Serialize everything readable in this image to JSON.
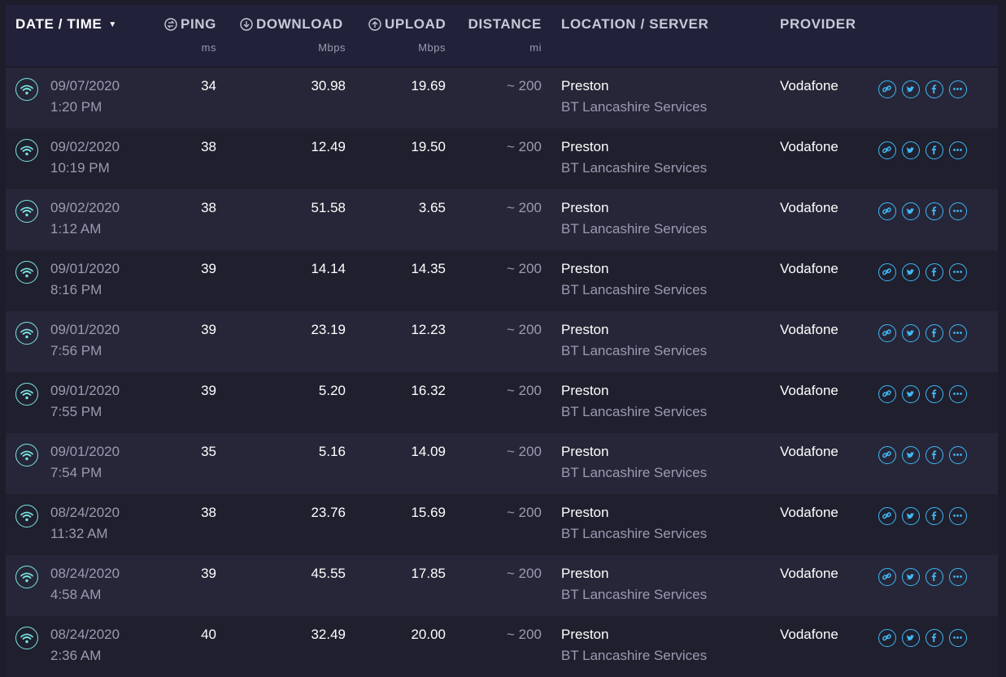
{
  "header": {
    "date_label": "DATE / TIME",
    "ping_label": "PING",
    "ping_unit": "ms",
    "download_label": "DOWNLOAD",
    "download_unit": "Mbps",
    "upload_label": "UPLOAD",
    "upload_unit": "Mbps",
    "distance_label": "DISTANCE",
    "distance_unit": "mi",
    "location_label": "LOCATION / SERVER",
    "provider_label": "PROVIDER"
  },
  "rows": [
    {
      "date": "09/07/2020",
      "time": "1:20 PM",
      "ping": "34",
      "download": "30.98",
      "upload": "19.69",
      "distance": "~ 200",
      "location": "Preston",
      "server": "BT Lancashire Services",
      "provider": "Vodafone"
    },
    {
      "date": "09/02/2020",
      "time": "10:19 PM",
      "ping": "38",
      "download": "12.49",
      "upload": "19.50",
      "distance": "~ 200",
      "location": "Preston",
      "server": "BT Lancashire Services",
      "provider": "Vodafone"
    },
    {
      "date": "09/02/2020",
      "time": "1:12 AM",
      "ping": "38",
      "download": "51.58",
      "upload": "3.65",
      "distance": "~ 200",
      "location": "Preston",
      "server": "BT Lancashire Services",
      "provider": "Vodafone"
    },
    {
      "date": "09/01/2020",
      "time": "8:16 PM",
      "ping": "39",
      "download": "14.14",
      "upload": "14.35",
      "distance": "~ 200",
      "location": "Preston",
      "server": "BT Lancashire Services",
      "provider": "Vodafone"
    },
    {
      "date": "09/01/2020",
      "time": "7:56 PM",
      "ping": "39",
      "download": "23.19",
      "upload": "12.23",
      "distance": "~ 200",
      "location": "Preston",
      "server": "BT Lancashire Services",
      "provider": "Vodafone"
    },
    {
      "date": "09/01/2020",
      "time": "7:55 PM",
      "ping": "39",
      "download": "5.20",
      "upload": "16.32",
      "distance": "~ 200",
      "location": "Preston",
      "server": "BT Lancashire Services",
      "provider": "Vodafone"
    },
    {
      "date": "09/01/2020",
      "time": "7:54 PM",
      "ping": "35",
      "download": "5.16",
      "upload": "14.09",
      "distance": "~ 200",
      "location": "Preston",
      "server": "BT Lancashire Services",
      "provider": "Vodafone"
    },
    {
      "date": "08/24/2020",
      "time": "11:32 AM",
      "ping": "38",
      "download": "23.76",
      "upload": "15.69",
      "distance": "~ 200",
      "location": "Preston",
      "server": "BT Lancashire Services",
      "provider": "Vodafone"
    },
    {
      "date": "08/24/2020",
      "time": "4:58 AM",
      "ping": "39",
      "download": "45.55",
      "upload": "17.85",
      "distance": "~ 200",
      "location": "Preston",
      "server": "BT Lancashire Services",
      "provider": "Vodafone"
    },
    {
      "date": "08/24/2020",
      "time": "2:36 AM",
      "ping": "40",
      "download": "32.49",
      "upload": "20.00",
      "distance": "~ 200",
      "location": "Preston",
      "server": "BT Lancashire Services",
      "provider": "Vodafone"
    }
  ],
  "row_icon": "wifi-icon",
  "action_icons": [
    "link-icon",
    "twitter-icon",
    "facebook-icon",
    "more-icon"
  ],
  "colors": {
    "accent": "#3fb8f5",
    "wifi": "#7be5e1",
    "background": "#1c1c2b",
    "row_a": "#262638",
    "row_b": "#1f1f2e",
    "header_bg": "#21223a",
    "muted_text": "#9a9bb0"
  }
}
